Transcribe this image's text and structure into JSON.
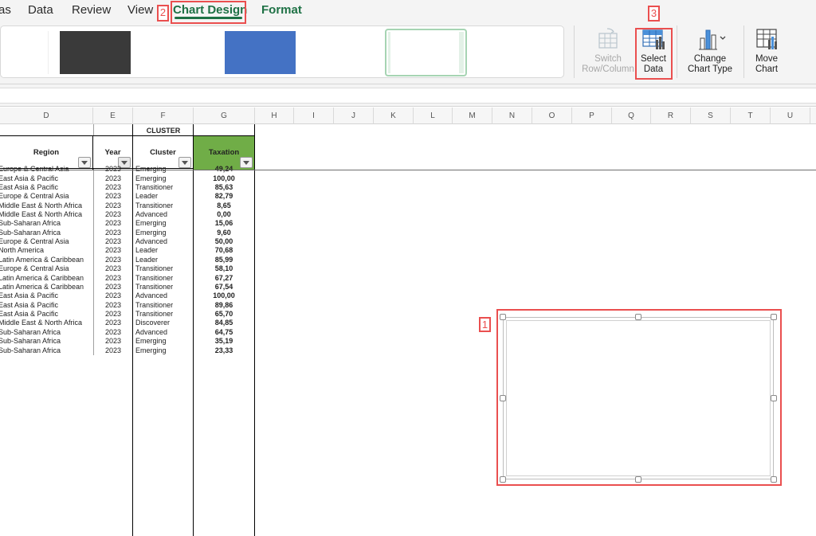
{
  "menu": {
    "items": [
      {
        "label": "as"
      },
      {
        "label": "Data"
      },
      {
        "label": "Review"
      },
      {
        "label": "View"
      },
      {
        "label": "Chart Design"
      },
      {
        "label": "Format"
      }
    ]
  },
  "ribbon": {
    "switch_label_1": "Switch",
    "switch_label_2": "Row/Column",
    "select_label_1": "Select",
    "select_label_2": "Data",
    "change_label_1": "Change",
    "change_label_2": "Chart Type",
    "move_label_1": "Move",
    "move_label_2": "Chart"
  },
  "grid": {
    "columns": [
      "D",
      "E",
      "F",
      "G",
      "H",
      "I",
      "J",
      "K",
      "L",
      "M",
      "N",
      "O",
      "P",
      "Q",
      "R",
      "S",
      "T",
      "U"
    ],
    "cluster_label": "CLUSTER",
    "headers": {
      "region": "Region",
      "year": "Year",
      "cluster": "Cluster",
      "taxation": "Taxation"
    },
    "partial_row": {
      "region": "Europe & Central Asia",
      "year": "2023",
      "cluster": "Emerging",
      "taxation": "49,24"
    },
    "rows": [
      {
        "region": "East Asia & Pacific",
        "year": "2023",
        "cluster": "Emerging",
        "taxation": "100,00"
      },
      {
        "region": "East Asia & Pacific",
        "year": "2023",
        "cluster": "Transitioner",
        "taxation": "85,63"
      },
      {
        "region": "Europe & Central Asia",
        "year": "2023",
        "cluster": "Leader",
        "taxation": "82,79"
      },
      {
        "region": "Middle East & North Africa",
        "year": "2023",
        "cluster": "Transitioner",
        "taxation": "8,65"
      },
      {
        "region": "Middle East & North Africa",
        "year": "2023",
        "cluster": "Advanced",
        "taxation": "0,00"
      },
      {
        "region": "Sub-Saharan Africa",
        "year": "2023",
        "cluster": "Emerging",
        "taxation": "15,06"
      },
      {
        "region": "Sub-Saharan Africa",
        "year": "2023",
        "cluster": "Emerging",
        "taxation": "9,60"
      },
      {
        "region": "Europe & Central Asia",
        "year": "2023",
        "cluster": "Advanced",
        "taxation": "50,00"
      },
      {
        "region": "North America",
        "year": "2023",
        "cluster": "Leader",
        "taxation": "70,68"
      },
      {
        "region": "Latin America & Caribbean",
        "year": "2023",
        "cluster": "Leader",
        "taxation": "85,99"
      },
      {
        "region": "Europe & Central Asia",
        "year": "2023",
        "cluster": "Transitioner",
        "taxation": "58,10"
      },
      {
        "region": "Latin America & Caribbean",
        "year": "2023",
        "cluster": "Transitioner",
        "taxation": "67,27"
      },
      {
        "region": "Latin America & Caribbean",
        "year": "2023",
        "cluster": "Transitioner",
        "taxation": "67,54"
      },
      {
        "region": "East Asia & Pacific",
        "year": "2023",
        "cluster": "Advanced",
        "taxation": "100,00"
      },
      {
        "region": "East Asia & Pacific",
        "year": "2023",
        "cluster": "Transitioner",
        "taxation": "89,86"
      },
      {
        "region": "East Asia & Pacific",
        "year": "2023",
        "cluster": "Transitioner",
        "taxation": "65,70"
      },
      {
        "region": "Middle East & North Africa",
        "year": "2023",
        "cluster": "Discoverer",
        "taxation": "84,85"
      },
      {
        "region": "Sub-Saharan Africa",
        "year": "2023",
        "cluster": "Advanced",
        "taxation": "64,75"
      },
      {
        "region": "Sub-Saharan Africa",
        "year": "2023",
        "cluster": "Emerging",
        "taxation": "35,19"
      },
      {
        "region": "Sub-Saharan Africa",
        "year": "2023",
        "cluster": "Emerging",
        "taxation": "23,33"
      }
    ]
  },
  "annotations": {
    "n1": "1",
    "n2": "2",
    "n3": "3"
  },
  "colors": {
    "accent": "#1e7145",
    "taxation_header": "#70ad47",
    "annotation": "#ea4f4f",
    "swatch_dark": "#3a3a3a",
    "swatch_blue": "#4472c4"
  }
}
